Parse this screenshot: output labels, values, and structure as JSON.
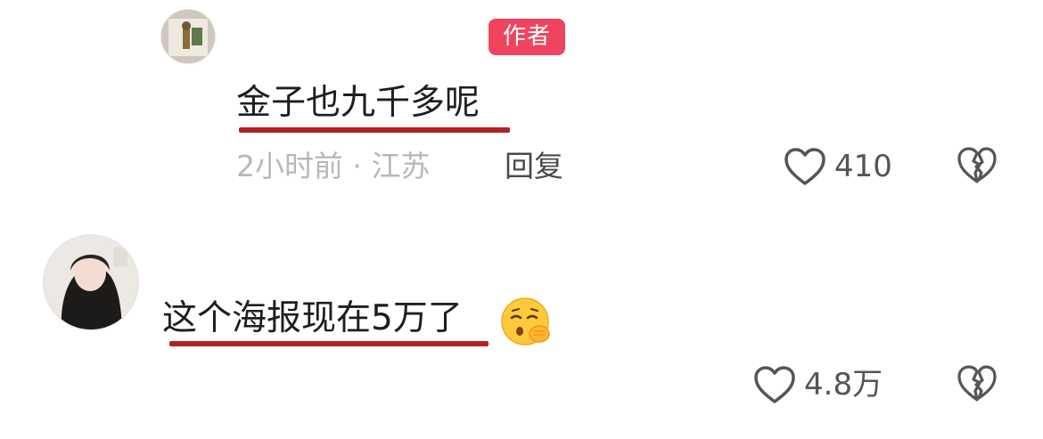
{
  "reply": {
    "author_badge": "作者",
    "text": "金子也九千多呢",
    "meta": "2小时前 · 江苏",
    "reply_label": "回复",
    "likes": "410"
  },
  "comment": {
    "text": "这个海报现在5万了",
    "emoji": "sleepy-face-shushing-emoji",
    "likes": "4.8万"
  },
  "icons": {
    "like": "heart-outline-icon",
    "dislike": "broken-heart-icon"
  },
  "colors": {
    "badge": "#f0445e",
    "underline": "#b22222",
    "meta_gray": "#b8b8b8"
  }
}
